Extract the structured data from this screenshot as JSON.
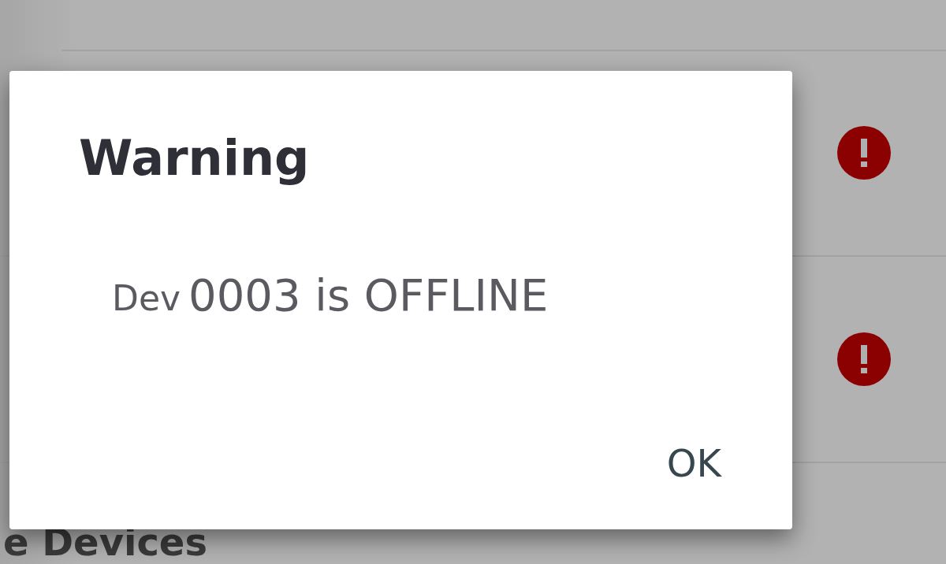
{
  "background": {
    "rows": [
      {
        "error": true
      },
      {
        "error": true
      }
    ],
    "section_heading": "e Devices"
  },
  "dialog": {
    "title": "Warning",
    "message_prefix": "Dev",
    "message": "0003 is OFFLINE",
    "buttons": [
      "OK"
    ]
  }
}
